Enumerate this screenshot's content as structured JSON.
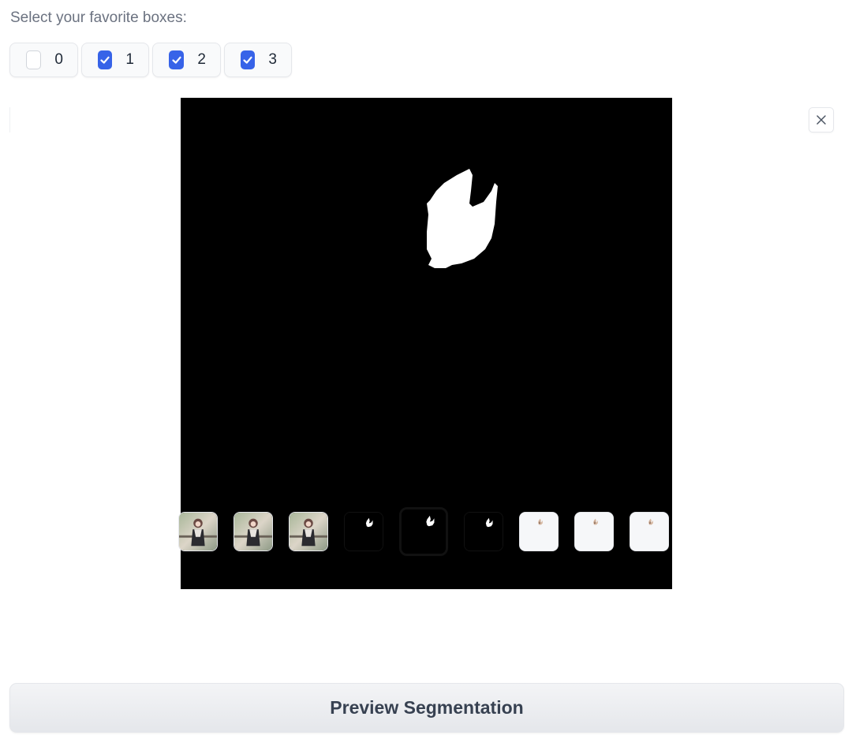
{
  "checkbox_group": {
    "label": "Select your favorite boxes:",
    "options": [
      {
        "label": "0",
        "checked": false
      },
      {
        "label": "1",
        "checked": true
      },
      {
        "label": "2",
        "checked": true
      },
      {
        "label": "3",
        "checked": true
      }
    ]
  },
  "gallery": {
    "close_icon": "close-icon",
    "selected_index": 4,
    "thumbnails": [
      {
        "kind": "photo"
      },
      {
        "kind": "photo"
      },
      {
        "kind": "photo"
      },
      {
        "kind": "mask"
      },
      {
        "kind": "mask"
      },
      {
        "kind": "mask"
      },
      {
        "kind": "overlay"
      },
      {
        "kind": "overlay"
      },
      {
        "kind": "overlay"
      }
    ]
  },
  "preview_button": {
    "label": "Preview Segmentation"
  },
  "colors": {
    "checkbox_accent": "#3763e8",
    "selected_thumb_border": "#e07a3a",
    "mask_background": "#000000",
    "mask_foreground": "#ffffff"
  }
}
